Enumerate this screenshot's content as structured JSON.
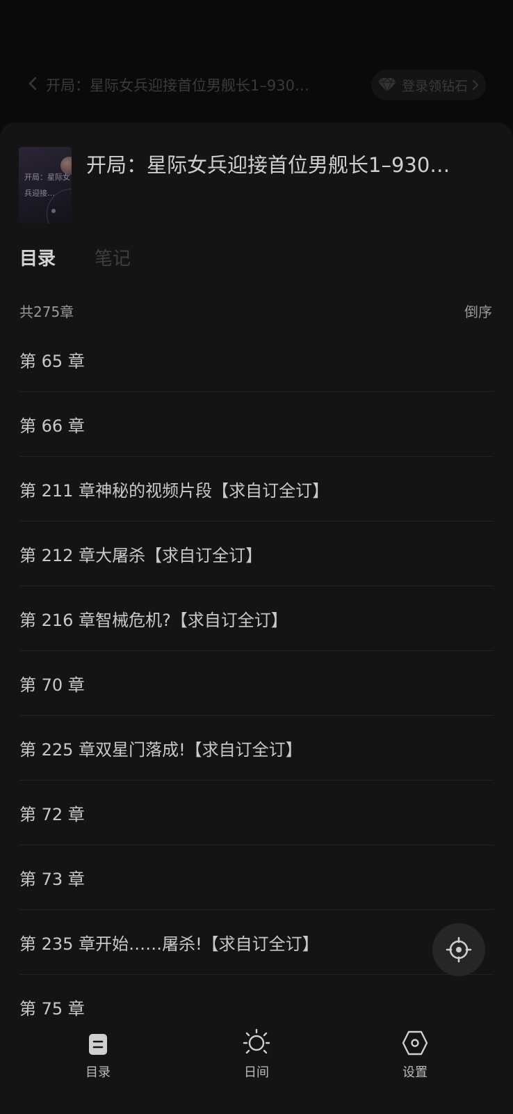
{
  "top_bar": {
    "title": "开局：星际女兵迎接首位男舰长1–930…",
    "promo_label": "登录领钻石"
  },
  "book": {
    "cover_text": "开局：星际女兵迎接…",
    "title": "开局：星际女兵迎接首位男舰长1–930…"
  },
  "tabs": [
    {
      "label": "目录",
      "active": true
    },
    {
      "label": "笔记",
      "active": false
    }
  ],
  "list_header": {
    "count_label": "共275章",
    "order_label": "倒序"
  },
  "chapters": [
    "第 65 章",
    "第 66 章",
    "第 211 章神秘的视频片段【求自订全订】",
    "第 212 章大屠杀【求自订全订】",
    "第 216 章智械危机?【求自订全订】",
    "第 70 章",
    "第 225 章双星门落成!【求自订全订】",
    "第 72 章",
    "第 73 章",
    "第 235 章开始……屠杀!【求自订全订】",
    "第 75 章"
  ],
  "bottom_nav": [
    {
      "label": "目录",
      "icon": "catalog-icon"
    },
    {
      "label": "日间",
      "icon": "sun-icon"
    },
    {
      "label": "设置",
      "icon": "settings-hexagon-icon"
    }
  ],
  "colors": {
    "background": "#0b0b0b",
    "sheet": "#141414",
    "text_primary": "#c9c9c9",
    "text_dim": "#3e3e3e",
    "divider": "#232323"
  }
}
